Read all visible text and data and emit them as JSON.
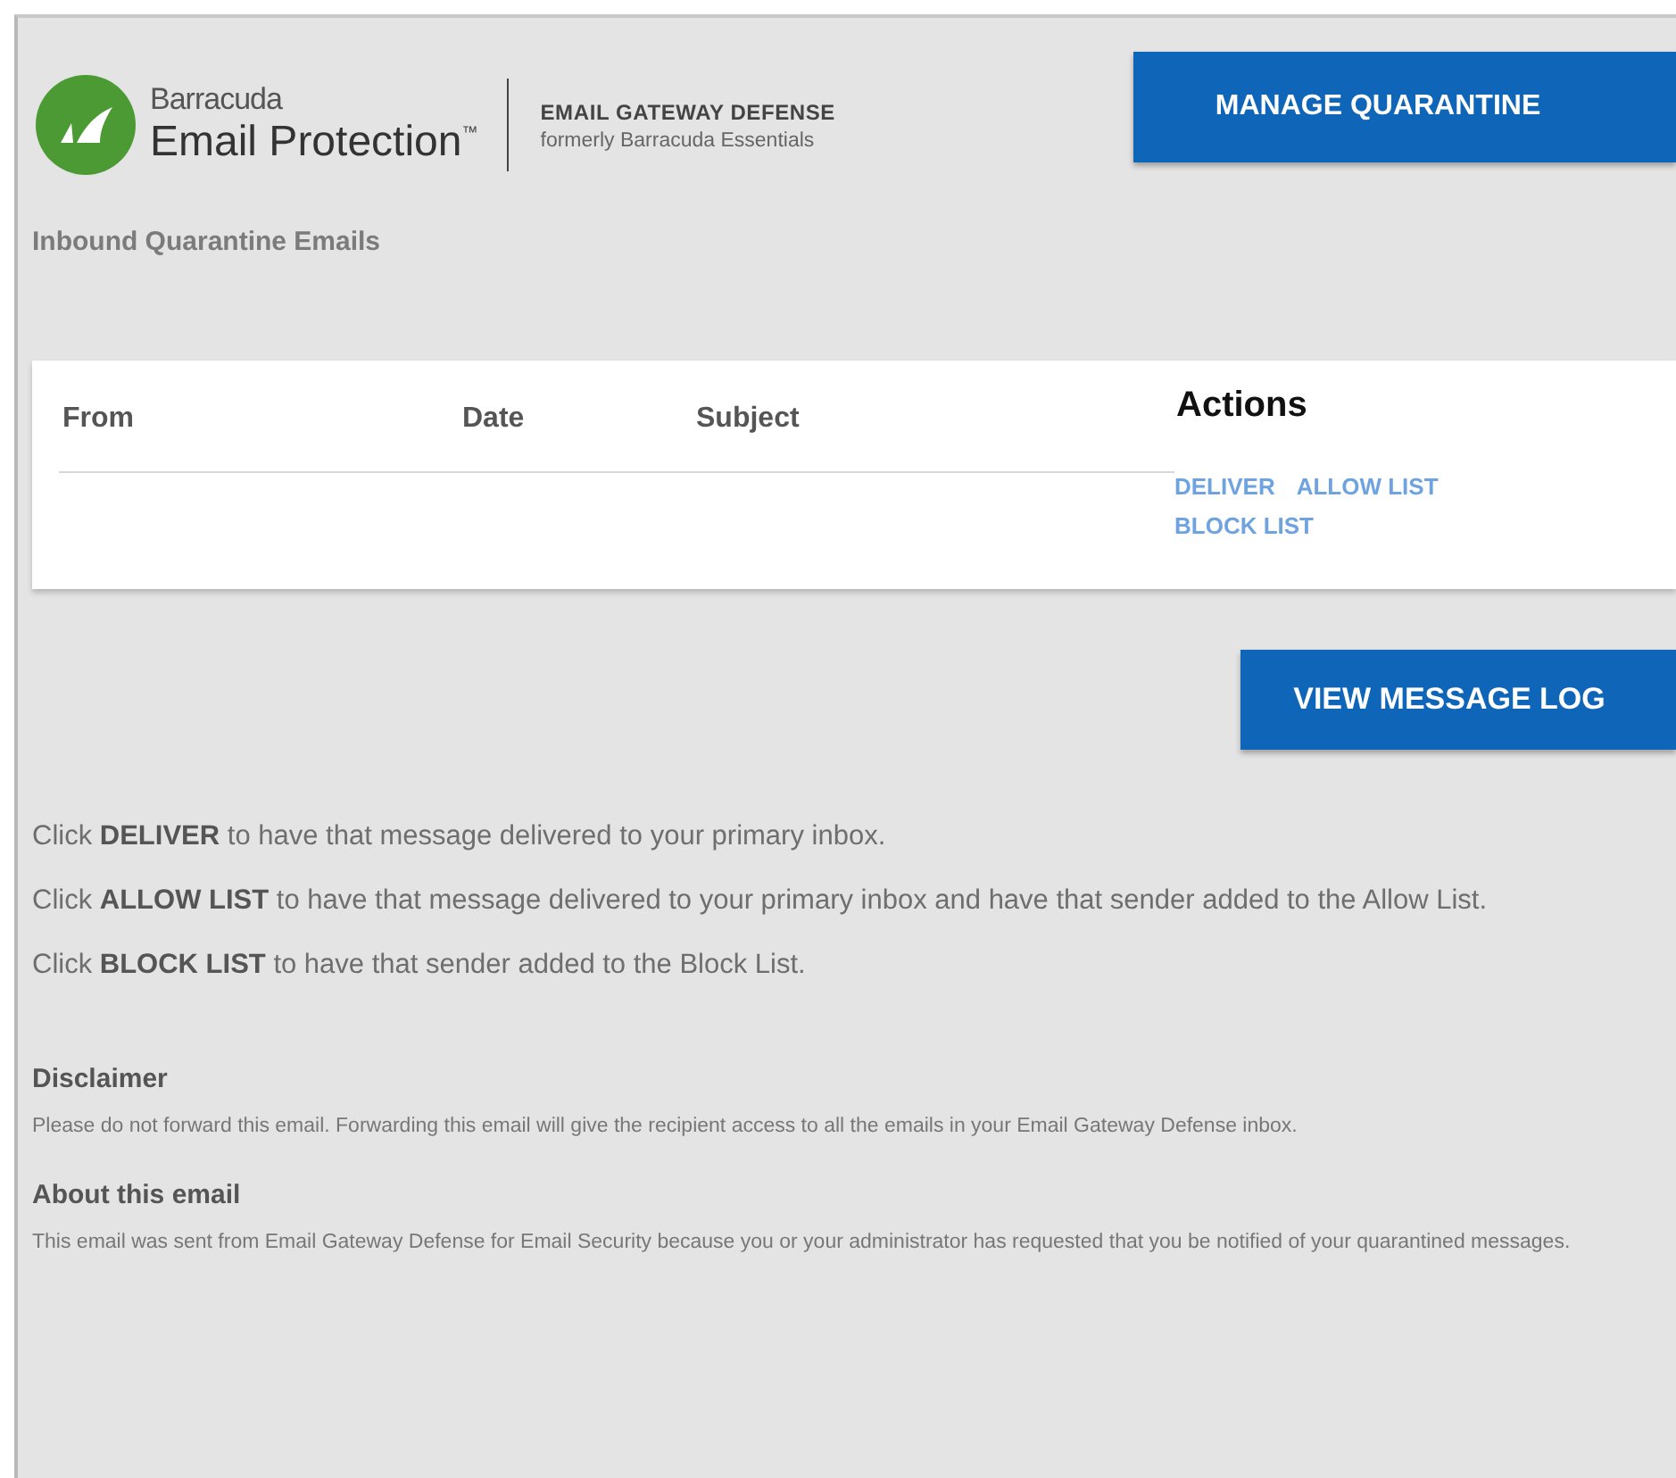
{
  "brand": {
    "company": "Barracuda",
    "product": "Email Protection",
    "trademark": "™",
    "service": "EMAIL GATEWAY DEFENSE",
    "formerly": "formerly Barracuda Essentials"
  },
  "manage_button": "MANAGE QUARANTINE",
  "section_title": "Inbound Quarantine Emails",
  "table": {
    "columns": [
      "From",
      "Date",
      "Subject"
    ],
    "actions_title": "Actions",
    "actions": [
      "DELIVER",
      "ALLOW LIST",
      "BLOCK LIST"
    ]
  },
  "log_button": "VIEW MESSAGE LOG",
  "instructions": [
    "Click **DELIVER** to have that message delivered to your primary inbox.",
    "Click **ALLOW LIST** to have that message delivered to your primary inbox and have that sender added to the Allow List.",
    "Click **BLOCK LIST** to have that sender added to the Block List."
  ],
  "notes": [
    {
      "heading": "Disclaimer",
      "text": "Please do not forward this email. Forwarding this email will give the recipient access to all the emails in your Email Gateway Defense inbox."
    },
    {
      "heading": "About this email",
      "text": "This email was sent from Email Gateway Defense for Email Security because you or your administrator has requested that you be notified of your quarantined messages."
    }
  ]
}
